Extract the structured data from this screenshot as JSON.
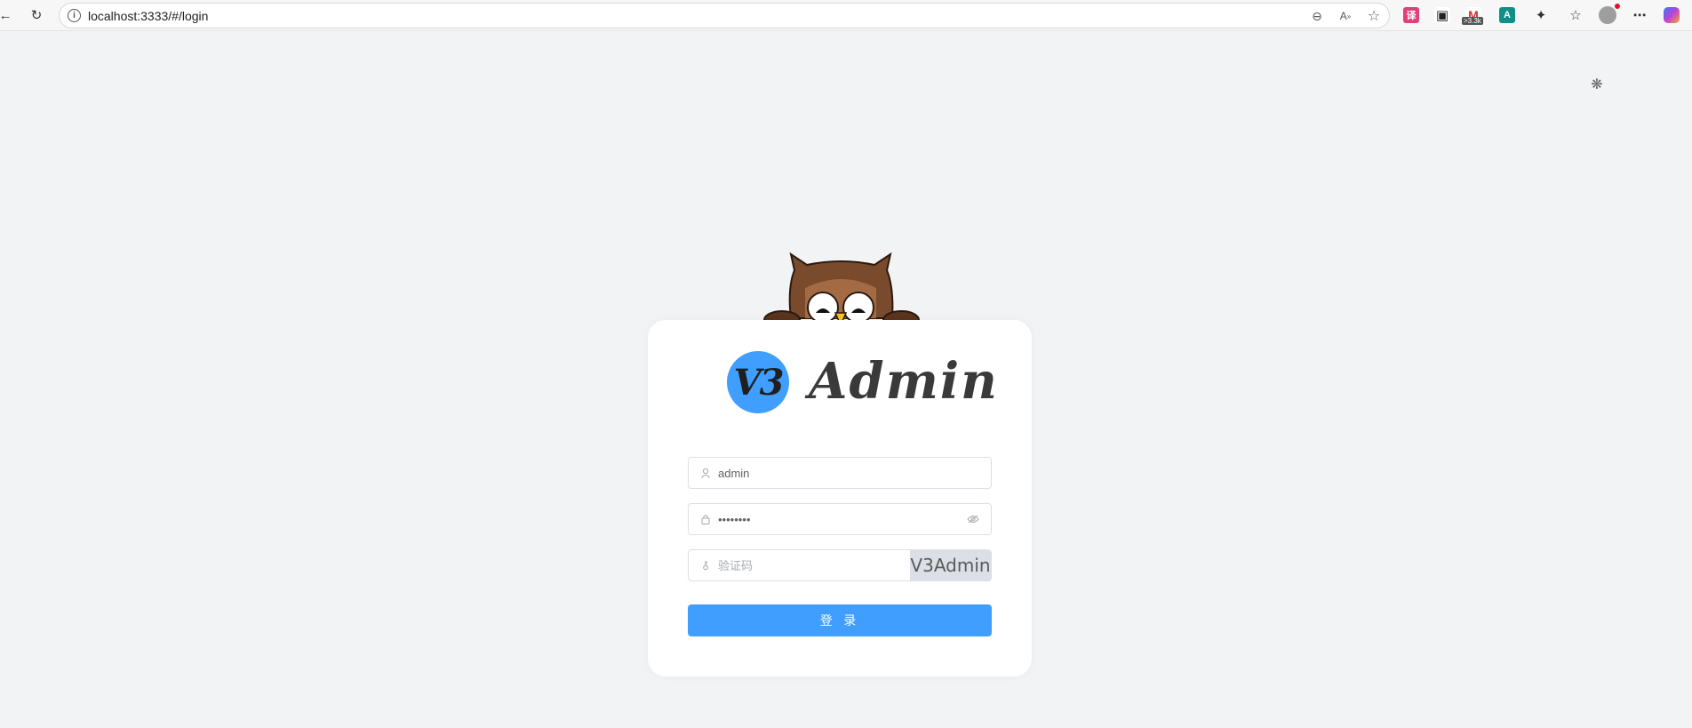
{
  "browser": {
    "url": "localhost:3333/#/login",
    "extensions": [
      {
        "name": "translate-ext-icon",
        "label": "译",
        "color": "#e0407a"
      },
      {
        "name": "game-ext-icon",
        "label": "▣",
        "color": "#222222"
      },
      {
        "name": "mail-ext-icon",
        "label": "M",
        "color": "#d93025",
        "badge": ">3.3k"
      },
      {
        "name": "font-ext-icon",
        "label": "A",
        "color": "#0f8f88"
      }
    ]
  },
  "login": {
    "brand": {
      "circle_text": "V3",
      "title": "Admin"
    },
    "username": {
      "value": "admin",
      "placeholder": ""
    },
    "password": {
      "value": "12345678",
      "placeholder": ""
    },
    "captcha": {
      "placeholder": "验证码",
      "image_text": "V3Admin"
    },
    "submit_label": "登 录"
  },
  "colors": {
    "primary": "#409eff",
    "background": "#f2f3f5",
    "card": "#ffffff"
  }
}
